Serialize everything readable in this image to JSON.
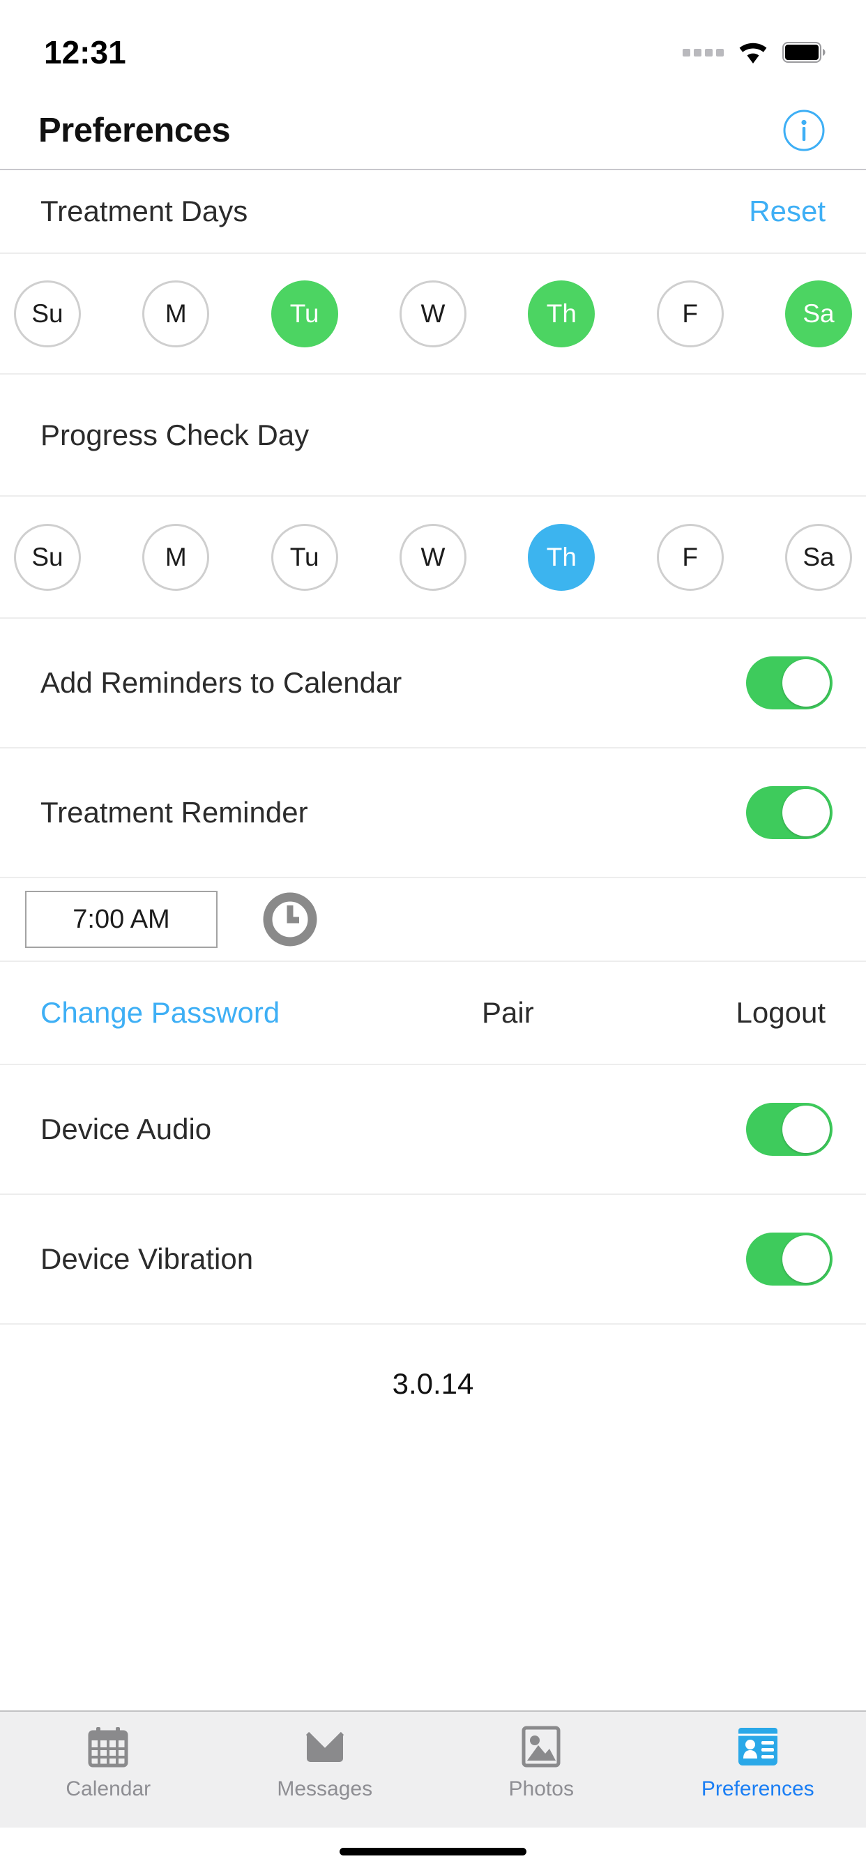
{
  "status_bar": {
    "time": "12:31",
    "signal_icon": "signal-dots-icon",
    "wifi_icon": "wifi-icon",
    "battery_icon": "battery-full-icon"
  },
  "nav": {
    "title": "Preferences",
    "info_icon": "info-circle-icon"
  },
  "treatment_days": {
    "label": "Treatment Days",
    "reset_label": "Reset",
    "days": [
      {
        "label": "Su",
        "selected": false
      },
      {
        "label": "M",
        "selected": false
      },
      {
        "label": "Tu",
        "selected": true
      },
      {
        "label": "W",
        "selected": false
      },
      {
        "label": "Th",
        "selected": true
      },
      {
        "label": "F",
        "selected": false
      },
      {
        "label": "Sa",
        "selected": true
      }
    ],
    "selected_color": "#4cd462"
  },
  "progress_check_day": {
    "label": "Progress Check Day",
    "days": [
      {
        "label": "Su",
        "selected": false
      },
      {
        "label": "M",
        "selected": false
      },
      {
        "label": "Tu",
        "selected": false
      },
      {
        "label": "W",
        "selected": false
      },
      {
        "label": "Th",
        "selected": true
      },
      {
        "label": "F",
        "selected": false
      },
      {
        "label": "Sa",
        "selected": false
      }
    ],
    "selected_color": "#3cb4ef"
  },
  "settings": {
    "add_reminders": {
      "label": "Add Reminders to Calendar",
      "on": true
    },
    "treatment_reminder": {
      "label": "Treatment Reminder",
      "on": true
    },
    "device_audio": {
      "label": "Device Audio",
      "on": true
    },
    "device_vibration": {
      "label": "Device Vibration",
      "on": true
    }
  },
  "reminder_time": {
    "value": "7:00 AM",
    "clock_icon": "clock-icon"
  },
  "actions": {
    "change_password": "Change Password",
    "pair": "Pair",
    "logout": "Logout",
    "link_color": "#3eaff5"
  },
  "version": "3.0.14",
  "tab_bar": {
    "tabs": [
      {
        "label": "Calendar",
        "icon": "calendar-icon",
        "active": false
      },
      {
        "label": "Messages",
        "icon": "envelope-icon",
        "active": false
      },
      {
        "label": "Photos",
        "icon": "photo-icon",
        "active": false
      },
      {
        "label": "Preferences",
        "icon": "id-card-icon",
        "active": true
      }
    ],
    "active_color": "#1a7ef4",
    "inactive_color": "#8e8e93"
  }
}
